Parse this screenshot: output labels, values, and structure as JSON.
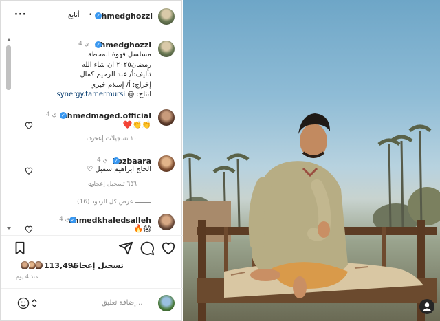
{
  "header": {
    "username": "ahmedghozzi",
    "follow_label": "أتابع",
    "separator": "•",
    "more_label": "···"
  },
  "caption": {
    "username": "ahmedghozzi",
    "time": "4 ي",
    "lines": [
      "مسلسل قهوة المحطة",
      "رمضان٢٠٢٥ ان شاء الله",
      "تأليف:أ/ عبد الرحيم كمال",
      "إخراج: أ/ إسلام خيري",
      "انتاج: @"
    ],
    "mention": "synergy.tamermursi"
  },
  "comments": [
    {
      "username": "ahmedmaged.official",
      "time": "4 ي",
      "text": "❤️👏👏",
      "likes": "١٠ تسجيلات إعجاب",
      "reply": "رد"
    },
    {
      "username": "kozbaara",
      "time": "4 ي",
      "text": "الحاج ابراهيم سمبل ♡",
      "likes": "٦٥٦ تسجيل إعجاب",
      "reply": "رد",
      "view_replies": "عرض كل الردود (16)"
    },
    {
      "username": "ahmedkhaledsalleh",
      "time": "4 ي",
      "text": "🔥😱"
    }
  ],
  "post": {
    "likes_count": "113,496",
    "likes_label": "تسجيل إعجاب",
    "time_ago": "منذ 4 يوم",
    "add_comment_placeholder": "إضافة تعليق..."
  },
  "colors": {
    "verified": "#3897f0",
    "link": "#00376b",
    "muted": "#8e8e8e"
  },
  "icons": [
    "more-icon",
    "verified-icon",
    "heart-icon",
    "bookmark-icon",
    "share-icon",
    "comment-icon",
    "emoji-icon",
    "profile-icon"
  ]
}
